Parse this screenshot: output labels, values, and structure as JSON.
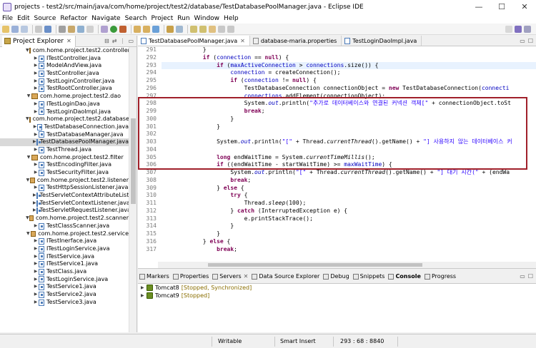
{
  "window": {
    "title": "projects - test2/src/main/java/com/home/project/test2/database/TestDatabasePoolManager.java - Eclipse IDE",
    "min_label": "—",
    "max_label": "☐",
    "close_label": "✕"
  },
  "menu": [
    "File",
    "Edit",
    "Source",
    "Refactor",
    "Navigate",
    "Search",
    "Project",
    "Run",
    "Window",
    "Help"
  ],
  "explorer": {
    "tab_label": "Project Explorer",
    "close_label": "✕",
    "tree": [
      {
        "label": "com.home.project.test2.controller",
        "kind": "package"
      },
      {
        "label": "ITestController.java",
        "kind": "file"
      },
      {
        "label": "ModelAndView.java",
        "kind": "file"
      },
      {
        "label": "TestController.java",
        "kind": "file"
      },
      {
        "label": "TestLoginController.java",
        "kind": "file"
      },
      {
        "label": "TestRootController.java",
        "kind": "file"
      },
      {
        "label": "com.home.project.test2.dao",
        "kind": "package"
      },
      {
        "label": "ITestLoginDao.java",
        "kind": "file"
      },
      {
        "label": "TestLoginDaoImpl.java",
        "kind": "file"
      },
      {
        "label": "com.home.project.test2.database",
        "kind": "package"
      },
      {
        "label": "TestDatabaseConnection.java",
        "kind": "file"
      },
      {
        "label": "TestDatabaseManager.java",
        "kind": "file"
      },
      {
        "label": "TestDatabasePoolManager.java",
        "kind": "file",
        "selected": true
      },
      {
        "label": "TestThread.java",
        "kind": "file"
      },
      {
        "label": "com.home.project.test2.filter",
        "kind": "package"
      },
      {
        "label": "TestEncodingFilter.java",
        "kind": "file"
      },
      {
        "label": "TestSecurityFilter.java",
        "kind": "file"
      },
      {
        "label": "com.home.project.test2.listener",
        "kind": "package"
      },
      {
        "label": "TestHttpSessionListener.java",
        "kind": "file"
      },
      {
        "label": "TestServletContextAttributeListe",
        "kind": "file"
      },
      {
        "label": "TestServletContextListener.java",
        "kind": "file"
      },
      {
        "label": "TestServletRequestListener.java",
        "kind": "file"
      },
      {
        "label": "com.home.project.test2.scanner",
        "kind": "package"
      },
      {
        "label": "TestClassScanner.java",
        "kind": "file"
      },
      {
        "label": "com.home.project.test2.service",
        "kind": "package"
      },
      {
        "label": "ITestInerface.java",
        "kind": "file"
      },
      {
        "label": "ITestLoginService.java",
        "kind": "file"
      },
      {
        "label": "ITestService.java",
        "kind": "file"
      },
      {
        "label": "ITestService1.java",
        "kind": "file"
      },
      {
        "label": "TestClass.java",
        "kind": "file"
      },
      {
        "label": "TestLoginService.java",
        "kind": "file"
      },
      {
        "label": "TestService1.java",
        "kind": "file"
      },
      {
        "label": "TestService2.java",
        "kind": "file"
      },
      {
        "label": "TestService3.java",
        "kind": "file"
      }
    ]
  },
  "editor": {
    "tabs": [
      {
        "label": "TestDatabasePoolManager.java",
        "active": true
      },
      {
        "label": "database-maria.properties",
        "active": false
      },
      {
        "label": "TestLoginDaoImpl.java",
        "active": false
      }
    ],
    "tab_close": "✕",
    "line_numbers": [
      "291",
      "292",
      "293",
      "294",
      "295",
      "296",
      "297",
      "298",
      "299",
      "300",
      "301",
      "302",
      "303",
      "304",
      "305",
      "306",
      "307",
      "308",
      "309",
      "310",
      "311",
      "312",
      "313",
      "314",
      "315",
      "316",
      "317"
    ]
  },
  "bottom": {
    "tabs": [
      "Markers",
      "Properties",
      "Servers",
      "Data Source Explorer",
      "Debug",
      "Snippets",
      "Console",
      "Progress"
    ],
    "active_tab": "Console",
    "servers": [
      {
        "name": "Tomcat8",
        "status": "[Stopped, Synchronized]"
      },
      {
        "name": "Tomcat9",
        "status": "[Stopped]"
      }
    ]
  },
  "status": {
    "mode": "Writable",
    "insert": "Smart Insert",
    "position": "293 : 68 : 8840"
  }
}
